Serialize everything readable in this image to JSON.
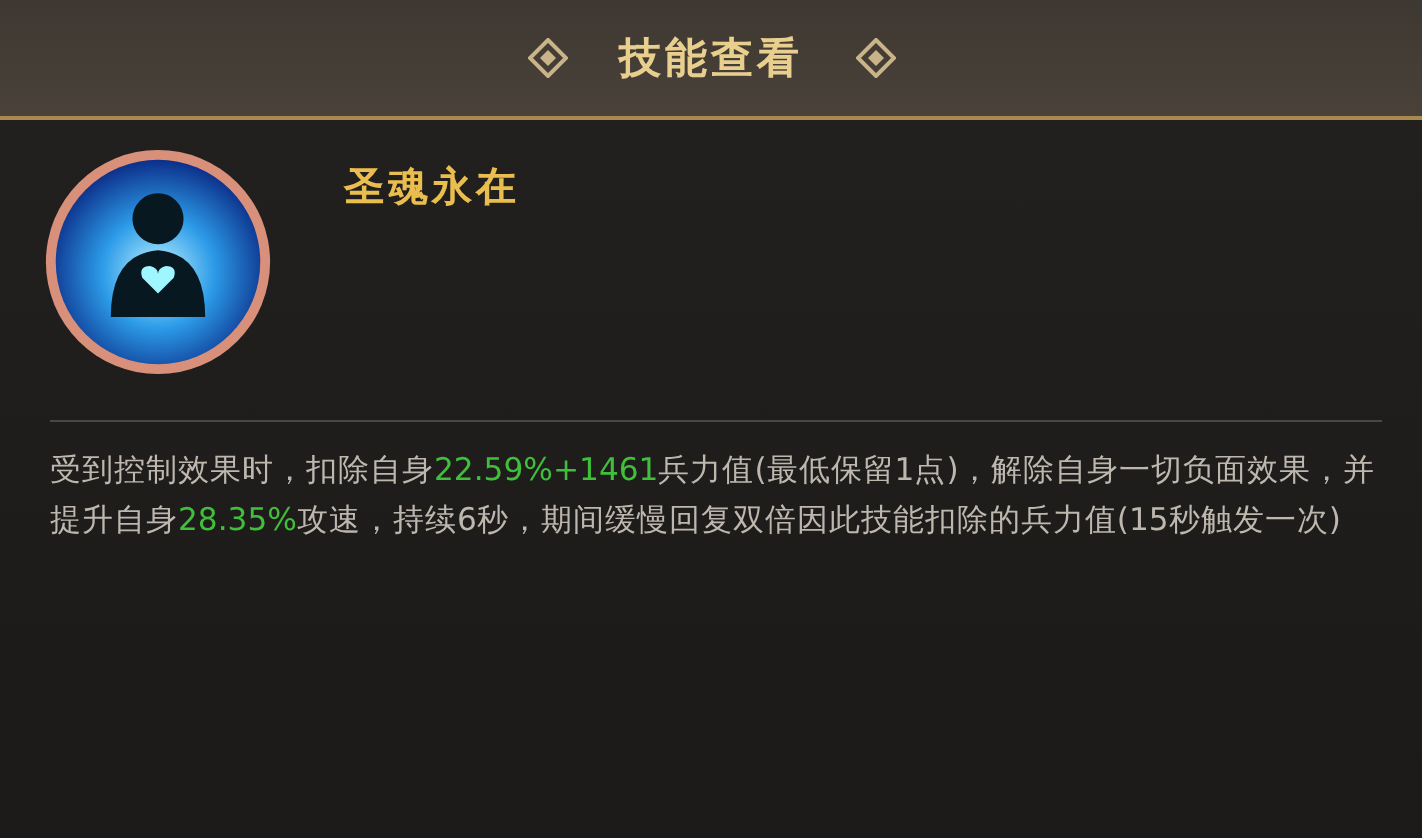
{
  "header": {
    "title": "技能查看"
  },
  "skill": {
    "name": "圣魂永在",
    "description": [
      {
        "kind": "plain",
        "text": "受到控制效果时，扣除自身"
      },
      {
        "kind": "highlight",
        "text": "22.59%+1461"
      },
      {
        "kind": "plain",
        "text": "兵力值(最低保留1点)，解除自身一切负面效果，并提升自身"
      },
      {
        "kind": "highlight",
        "text": "28.35%"
      },
      {
        "kind": "plain",
        "text": "攻速，持续6秒，期间缓慢回复双倍因此技能扣除的兵力值(15秒触发一次)"
      }
    ]
  }
}
